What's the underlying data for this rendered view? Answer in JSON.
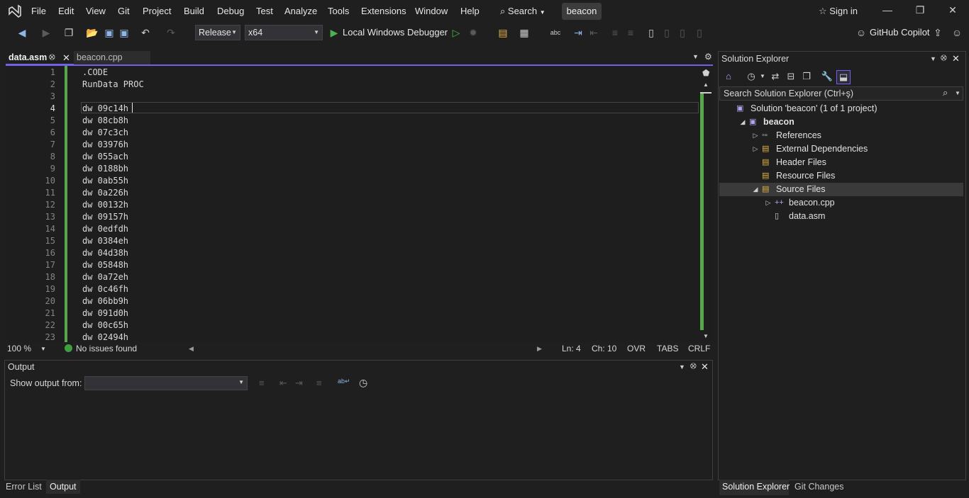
{
  "menu": {
    "items": [
      "File",
      "Edit",
      "View",
      "Git",
      "Project",
      "Build",
      "Debug",
      "Test",
      "Analyze",
      "Tools",
      "Extensions",
      "Window",
      "Help"
    ],
    "search_label": "Search",
    "project_badge": "beacon",
    "sign_in": "Sign in"
  },
  "toolbar": {
    "config": "Release",
    "platform": "x64",
    "run_label": "Local Windows Debugger",
    "copilot": "GitHub Copilot"
  },
  "editor": {
    "tabs": [
      {
        "label": "data.asm",
        "active": true
      },
      {
        "label": "beacon.cpp",
        "active": false
      }
    ],
    "lines": [
      {
        "n": "1",
        "text": ".CODE"
      },
      {
        "n": "2",
        "text": "RunData PROC"
      },
      {
        "n": "3",
        "text": ""
      },
      {
        "n": "4",
        "text": "dw 09c14h"
      },
      {
        "n": "5",
        "text": "dw 08cb8h"
      },
      {
        "n": "6",
        "text": "dw 07c3ch"
      },
      {
        "n": "7",
        "text": "dw 03976h"
      },
      {
        "n": "8",
        "text": "dw 055ach"
      },
      {
        "n": "9",
        "text": "dw 0188bh"
      },
      {
        "n": "10",
        "text": "dw 0ab55h"
      },
      {
        "n": "11",
        "text": "dw 0a226h"
      },
      {
        "n": "12",
        "text": "dw 00132h"
      },
      {
        "n": "13",
        "text": "dw 09157h"
      },
      {
        "n": "14",
        "text": "dw 0edfdh"
      },
      {
        "n": "15",
        "text": "dw 0384eh"
      },
      {
        "n": "16",
        "text": "dw 04d38h"
      },
      {
        "n": "17",
        "text": "dw 05848h"
      },
      {
        "n": "18",
        "text": "dw 0a72eh"
      },
      {
        "n": "19",
        "text": "dw 0c46fh"
      },
      {
        "n": "20",
        "text": "dw 06bb9h"
      },
      {
        "n": "21",
        "text": "dw 091d0h"
      },
      {
        "n": "22",
        "text": "dw 00c65h"
      },
      {
        "n": "23",
        "text": "dw 02494h"
      }
    ],
    "current_line": "4"
  },
  "status": {
    "zoom": "100 %",
    "issues": "No issues found",
    "ln": "Ln: 4",
    "ch": "Ch: 10",
    "ovr": "OVR",
    "tabs": "TABS",
    "crlf": "CRLF"
  },
  "output": {
    "title": "Output",
    "show_from_label": "Show output from:",
    "show_from_value": ""
  },
  "bottom_tabs": {
    "errors": "Error List",
    "output": "Output"
  },
  "solution_explorer": {
    "title": "Solution Explorer",
    "search_placeholder": "Search Solution Explorer (Ctrl+ş)",
    "tree": [
      {
        "label": "Solution 'beacon' (1 of 1 project)",
        "icon": "solution-icon",
        "expander": "",
        "bold": false,
        "selected": false
      },
      {
        "label": "beacon",
        "icon": "project-icon",
        "expander": "expanded",
        "bold": true,
        "selected": false
      },
      {
        "label": "References",
        "icon": "references-icon",
        "expander": "collapsed",
        "bold": false,
        "selected": false
      },
      {
        "label": "External Dependencies",
        "icon": "folder-icon",
        "expander": "collapsed",
        "bold": false,
        "selected": false
      },
      {
        "label": "Header Files",
        "icon": "folder-icon",
        "expander": "",
        "bold": false,
        "selected": false
      },
      {
        "label": "Resource Files",
        "icon": "folder-icon",
        "expander": "",
        "bold": false,
        "selected": false
      },
      {
        "label": "Source Files",
        "icon": "folder-open-icon",
        "expander": "expanded",
        "bold": false,
        "selected": true
      },
      {
        "label": "beacon.cpp",
        "icon": "cpp-file-icon",
        "expander": "collapsed",
        "bold": false,
        "selected": false
      },
      {
        "label": "data.asm",
        "icon": "file-icon",
        "expander": "",
        "bold": false,
        "selected": false
      }
    ],
    "tabs": {
      "solution_explorer": "Solution Explorer",
      "git_changes": "Git Changes"
    }
  },
  "colors": {
    "accent": "#7160e8",
    "change_bar": "#57a64a",
    "ok": "#3fa03f"
  }
}
